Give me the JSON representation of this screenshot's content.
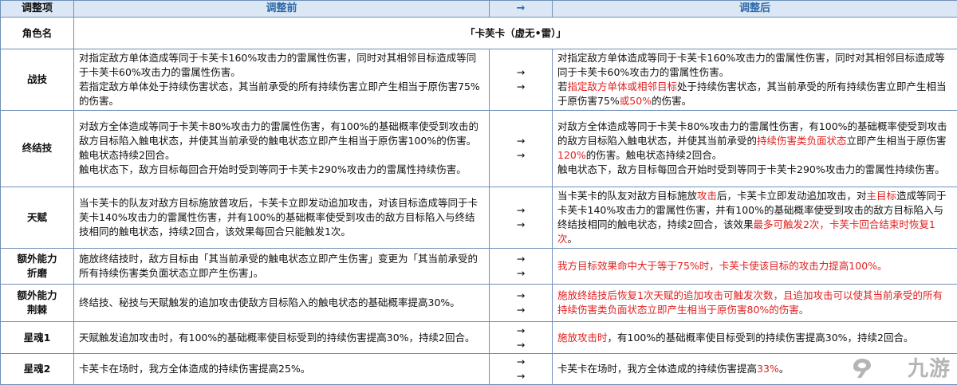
{
  "header": {
    "col_item": "调整项",
    "col_before": "调整前",
    "col_arrow": "→",
    "col_after": "调整后"
  },
  "character_row": {
    "label": "角色名",
    "value": "「卡芙卡（虚无•雷）」"
  },
  "rows": [
    {
      "label": "战技",
      "before": [
        [
          {
            "t": "对指定敌方单体造成等同于卡芙卡160%攻击力的雷属性伤害，同时对其相邻目标造成等同于卡芙卡60%攻击力的雷属性伤害。",
            "r": false
          }
        ],
        [
          {
            "t": "若指定敌方单体处于持续伤害状态，其当前承受的所有持续伤害立即产生相当于原伤害75%的伤害。",
            "r": false
          }
        ]
      ],
      "arrows": [
        "→",
        "→"
      ],
      "after": [
        [
          {
            "t": "对指定敌方单体造成等同于卡芙卡160%攻击力的雷属性伤害，同时对其相邻目标造成等同于卡芙卡60%攻击力的雷属性伤害。",
            "r": false
          }
        ],
        [
          {
            "t": "若",
            "r": false
          },
          {
            "t": "指定敌方单体或相邻目标",
            "r": true
          },
          {
            "t": "处于持续伤害状态，其当前承受的所有持续伤害立即产生相当于原伤害75%",
            "r": false
          },
          {
            "t": "或50%",
            "r": true
          },
          {
            "t": "的伤害。",
            "r": false
          }
        ]
      ]
    },
    {
      "label": "终结技",
      "before": [
        [
          {
            "t": "对敌方全体造成等同于卡芙卡80%攻击力的雷属性伤害，有100%的基础概率使受到攻击的敌方目标陷入触电状态，并使其当前承受的触电状态立即产生相当于原伤害100%的伤害。触电状态持续2回合。",
            "r": false
          }
        ],
        [
          {
            "t": "触电状态下，敌方目标每回合开始时受到等同于卡芙卡290%攻击力的雷属性持续伤害。",
            "r": false
          }
        ]
      ],
      "arrows": [
        "→",
        "→"
      ],
      "after": [
        [
          {
            "t": "对敌方全体造成等同于卡芙卡80%攻击力的雷属性伤害，有100%的基础概率使受到攻击的敌方目标陷入触电状态，并使其当前承受的",
            "r": false
          },
          {
            "t": "持续伤害类负面状态",
            "r": true
          },
          {
            "t": "立即产生相当于原伤害",
            "r": false
          },
          {
            "t": "120%",
            "r": true
          },
          {
            "t": "的伤害。触电状态持续2回合。",
            "r": false
          }
        ],
        [
          {
            "t": "触电状态下，敌方目标每回合开始时受到等同于卡芙卡290%攻击力的雷属性持续伤害。",
            "r": false
          }
        ]
      ]
    },
    {
      "label": "天赋",
      "before": [
        [
          {
            "t": "当卡芙卡的队友对敌方目标施放普攻后，卡芙卡立即发动追加攻击，对该目标造成等同于卡芙卡140%攻击力的雷属性伤害，并有100%的基础概率使受到攻击的敌方目标陷入与终结技相同的触电状态，持续2回合，该效果每回合只能触发1次。",
            "r": false
          }
        ]
      ],
      "arrows": [
        "→",
        "→"
      ],
      "after": [
        [
          {
            "t": "当卡芙卡的队友对敌方目标施放",
            "r": false
          },
          {
            "t": "攻击",
            "r": true
          },
          {
            "t": "后，卡芙卡立即发动追加攻击，对",
            "r": false
          },
          {
            "t": "主目标",
            "r": true
          },
          {
            "t": "造成等同于卡芙卡140%攻击力的雷属性伤害，并有100%的基础概率使受到攻击的敌方目标陷入与终结技相同的触电状态，持续2回合，该效果",
            "r": false
          },
          {
            "t": "最多可触发2次，卡芙卡回合结束时恢复1次",
            "r": true
          },
          {
            "t": "。",
            "r": false
          }
        ]
      ]
    },
    {
      "label": "额外能力\n折磨",
      "before": [
        [
          {
            "t": "施放终结技时，敌方目标由「其当前承受的触电状态立即产生伤害」变更为「其当前承受的所有持续伤害类负面状态立即产生伤害」。",
            "r": false
          }
        ]
      ],
      "arrows": [
        "→",
        "→"
      ],
      "after": [
        [
          {
            "t": "我方目标效果命中大于等于75%时，卡芙卡使该目标的攻击力提高100%。",
            "r": true
          }
        ]
      ]
    },
    {
      "label": "额外能力\n荆棘",
      "before": [
        [
          {
            "t": "终结技、秘技与天赋触发的追加攻击使敌方目标陷入的触电状态的基础概率提高30%。",
            "r": false
          }
        ]
      ],
      "arrows": [
        "→",
        "→"
      ],
      "after": [
        [
          {
            "t": "施放终结技后恢复1次天赋的追加攻击可触发次数，且追加攻击可以使其当前承受的所有持续伤害类负面状态立即产生相当于原伤害80%的伤害。",
            "r": true
          }
        ]
      ]
    },
    {
      "label": "星魂1",
      "before": [
        [
          {
            "t": "天赋触发追加攻击时，有100%的基础概率使目标受到的持续伤害提高30%，持续2回合。",
            "r": false
          }
        ]
      ],
      "arrows": [
        "→",
        "→"
      ],
      "after": [
        [
          {
            "t": "施放攻击时",
            "r": true
          },
          {
            "t": "，有100%的基础概率使目标受到的持续伤害提高30%，持续2回合。",
            "r": false
          }
        ]
      ]
    },
    {
      "label": "星魂2",
      "before": [
        [
          {
            "t": "卡芙卡在场时，我方全体造成的持续伤害提高25%。",
            "r": false
          }
        ]
      ],
      "arrows": [
        "→",
        "→"
      ],
      "after": [
        [
          {
            "t": "卡芙卡在场时，我方全体造成的持续伤害提高",
            "r": false
          },
          {
            "t": "33%",
            "r": true
          },
          {
            "t": "。",
            "r": false
          }
        ]
      ]
    }
  ],
  "watermark": {
    "text": "九游",
    "icon": "jiuyou-logo-icon"
  },
  "colors": {
    "header_bg": "#dbe7f4",
    "header_text": "#2f6aaa",
    "border": "#6f8fb8",
    "highlight": "#e02020"
  }
}
